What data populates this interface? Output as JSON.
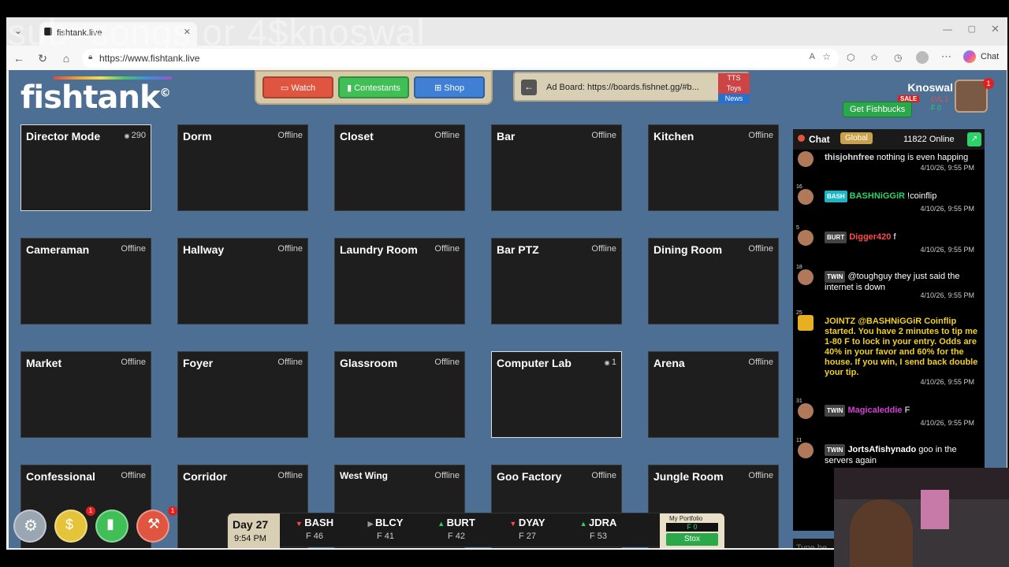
{
  "overlay_text": "sub=songs or 4$knoswal",
  "browser": {
    "tab_title": "fishtank.live",
    "url": "https://www.fishtank.live",
    "copilot_label": "Chat"
  },
  "nav": {
    "watch": "Watch",
    "contestants": "Contestants",
    "shop": "Shop"
  },
  "ad_board": {
    "text": "Ad Board: https://boards.fishnet.gg/#b...",
    "tabs": [
      "TTS",
      "Toys",
      "News"
    ]
  },
  "user": {
    "name": "Knoswal",
    "fishbucks_label": "Get Fishbucks",
    "sale_label": "SALE",
    "level": "LVL 1",
    "balance": "F 0",
    "notif_count": "1"
  },
  "cameras": [
    {
      "name": "Director Mode",
      "status": "290",
      "live": true
    },
    {
      "name": "Dorm",
      "status": "Offline",
      "live": false
    },
    {
      "name": "Closet",
      "status": "Offline",
      "live": false
    },
    {
      "name": "Bar",
      "status": "Offline",
      "live": false
    },
    {
      "name": "Kitchen",
      "status": "Offline",
      "live": false
    },
    {
      "name": "Cameraman",
      "status": "Offline",
      "live": false
    },
    {
      "name": "Hallway",
      "status": "Offline",
      "live": false
    },
    {
      "name": "Laundry Room",
      "status": "Offline",
      "live": false
    },
    {
      "name": "Bar PTZ",
      "status": "Offline",
      "live": false
    },
    {
      "name": "Dining Room",
      "status": "Offline",
      "live": false
    },
    {
      "name": "Market",
      "status": "Offline",
      "live": false
    },
    {
      "name": "Foyer",
      "status": "Offline",
      "live": false
    },
    {
      "name": "Glassroom",
      "status": "Offline",
      "live": false
    },
    {
      "name": "Computer Lab",
      "status": "1",
      "live": true
    },
    {
      "name": "Arena",
      "status": "Offline",
      "live": false
    },
    {
      "name": "Confessional",
      "status": "Offline",
      "live": false
    },
    {
      "name": "Corridor",
      "status": "Offline",
      "live": false
    },
    {
      "name": "West Wing",
      "status": "Offline",
      "live": false
    },
    {
      "name": "Goo Factory",
      "status": "Offline",
      "live": false
    },
    {
      "name": "Jungle Room",
      "status": "Offline",
      "live": false
    }
  ],
  "chat": {
    "title": "Chat",
    "scope": "Global",
    "online": "11822 Online",
    "input_placeholder": "Type he",
    "messages": [
      {
        "level": "",
        "tag": "",
        "user": "thisjohnfree",
        "text": "nothing is even happing",
        "time": "4/10/26, 9:55 PM"
      },
      {
        "level": "16",
        "tag": "BASH",
        "user": "BASHNiGGiR",
        "text": "!coinflip",
        "time": "4/10/26, 9:55 PM"
      },
      {
        "level": "5",
        "tag": "BURT",
        "user": "Digger420",
        "text": "f",
        "time": "4/10/26, 9:55 PM"
      },
      {
        "level": "18",
        "tag": "TWIN",
        "user": "",
        "text": "@toughguy they just said the internet is down",
        "time": "4/10/26, 9:55 PM"
      },
      {
        "level": "25",
        "tag": "",
        "user": "JOINTZ",
        "text": "@BASHNiGGiR Coinflip started. You have 2 minutes to tip me 1-80 F to lock in your entry. Odds are 40% in your favor and 60% for the house. If you win, I send back double your tip.",
        "time": "4/10/26, 9:55 PM"
      },
      {
        "level": "31",
        "tag": "TWIN",
        "user": "Magicaleddie",
        "text": "F",
        "time": "4/10/26, 9:55 PM"
      },
      {
        "level": "11",
        "tag": "TWIN",
        "user": "JortsAfishynado",
        "text": "goo in the servers again",
        "time": ""
      }
    ]
  },
  "stox": {
    "day": "Day 27",
    "time": "9:54 PM",
    "tickers": [
      {
        "sym": "BASH",
        "price": "F 46",
        "dir": "down"
      },
      {
        "sym": "BLCY",
        "price": "F 41",
        "dir": "flat"
      },
      {
        "sym": "BURT",
        "price": "F 42",
        "dir": "up"
      },
      {
        "sym": "DYAY",
        "price": "F 27",
        "dir": "down"
      },
      {
        "sym": "JDRA",
        "price": "F 53",
        "dir": "up"
      }
    ],
    "portfolio_label": "My Portfolio",
    "portfolio_value": "F 0",
    "stox_button": "Stox"
  },
  "bottom_badges": {
    "coins": "1",
    "fire": "1"
  },
  "colors": {
    "app_bg": "#4d6f94",
    "watch": "#e0553f",
    "contestants": "#3fbf55",
    "shop": "#3f7fd6",
    "live_green": "#2dd36a"
  }
}
